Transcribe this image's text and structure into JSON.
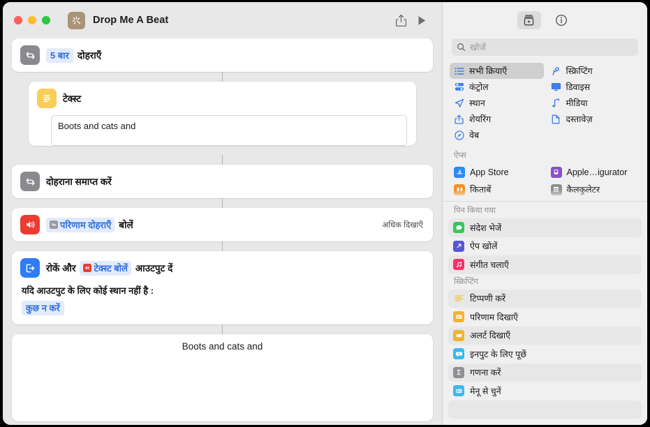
{
  "window": {
    "title": "Drop Me A Beat",
    "app_icon": "sparkle-wand-icon",
    "accent_blue": "#2f6fe0",
    "traffic_lights": [
      "close",
      "minimize",
      "zoom"
    ]
  },
  "toolbar": {
    "share_label": "share-icon",
    "run_label": "run-icon"
  },
  "workflow": {
    "actions": [
      {
        "name": "repeat",
        "icon": "repeat-icon",
        "icon_color": "#8a8a8e",
        "count_token": "5 बार",
        "label": "दोहराएँ"
      },
      {
        "name": "text",
        "icon": "text-icon",
        "icon_color": "#f7cf57",
        "label": "टेक्स्ट",
        "value": "Boots and cats and"
      },
      {
        "name": "end-repeat",
        "icon": "repeat-icon",
        "icon_color": "#8a8a8e",
        "label": "दोहराना समाप्त करें"
      },
      {
        "name": "speak",
        "icon": "speaker-icon",
        "icon_color": "#ec3b32",
        "token": "परिणाम दोहराएँ",
        "label": "बोलें",
        "show_more": "अधिक दिखाएँ"
      },
      {
        "name": "stop-and-output",
        "icon": "stop-output-icon",
        "icon_color": "#2f7cf6",
        "label_before": "रोकें और",
        "token": "टेक्स्ट बोलें",
        "label_after": "आउटपुट दें",
        "condition_label": "यदि आउटपुट के लिए कोई स्थान नहीं है :",
        "condition_token": "कुछ न करें"
      }
    ],
    "output_preview": "Boots and cats and"
  },
  "library": {
    "toolbar": {
      "library_icon": "action-library-icon",
      "info_icon": "info-icon"
    },
    "search": {
      "placeholder": "खोजें",
      "value": "",
      "icon": "search-icon"
    },
    "categories": [
      {
        "label": "सभी क्रियाएँ",
        "icon": "list-icon",
        "selected": true
      },
      {
        "label": "स्क्रिप्टिंग",
        "icon": "scripting-icon",
        "selected": false
      },
      {
        "label": "कंट्रोल",
        "icon": "controls-icon",
        "selected": false
      },
      {
        "label": "डिवाइस",
        "icon": "device-icon",
        "selected": false
      },
      {
        "label": "स्थान",
        "icon": "location-icon",
        "selected": false
      },
      {
        "label": "मीडिया",
        "icon": "media-note-icon",
        "selected": false
      },
      {
        "label": "शेयरिंग",
        "icon": "share-icon",
        "selected": false
      },
      {
        "label": "दस्तावेज़",
        "icon": "document-icon",
        "selected": false
      },
      {
        "label": "वेब",
        "icon": "web-compass-icon",
        "selected": false
      }
    ],
    "apps_section": {
      "header": "ऐप्स",
      "items": [
        {
          "label": "App Store",
          "icon": "app-store-icon",
          "color": "#2f8af6"
        },
        {
          "label": "Apple…igurator",
          "icon": "apple-configurator-icon",
          "color": "#8b4fc9"
        },
        {
          "label": "किताबें",
          "icon": "books-icon",
          "color": "#f59023"
        },
        {
          "label": "कैलकुलेटर",
          "icon": "calculator-icon",
          "color": "#8e8e93"
        }
      ]
    },
    "pinned_section": {
      "header": "पिन किया गया",
      "items": [
        {
          "label": "संदेश भेजें",
          "icon": "messages-icon",
          "color": "#35c759",
          "alt": true
        },
        {
          "label": "ऐप खोलें",
          "icon": "open-app-icon",
          "color": "#5656d6",
          "alt": false
        },
        {
          "label": "संगीत चलाएँ",
          "icon": "music-icon",
          "color": "#f8306c",
          "alt": true
        }
      ]
    },
    "scripting_section": {
      "header": "स्क्रिप्टिंग",
      "items": [
        {
          "label": "टिप्पणी करें",
          "icon": "comment-icon",
          "color": "#f7cf57",
          "alt": true
        },
        {
          "label": "परिणाम दिखाएँ",
          "icon": "show-result-icon",
          "color": "#f2b233",
          "alt": false
        },
        {
          "label": "अलर्ट दिखाएँ",
          "icon": "show-alert-icon",
          "color": "#f2b233",
          "alt": true
        },
        {
          "label": "इनपुट के लिए पूछें",
          "icon": "ask-input-icon",
          "color": "#3cb8ef",
          "alt": false
        },
        {
          "label": "गणना करें",
          "icon": "calculate-icon",
          "color": "#8e8e93",
          "alt": true
        },
        {
          "label": "मेनू से चुनें",
          "icon": "choose-menu-icon",
          "color": "#3cb8ef",
          "alt": false
        }
      ]
    }
  }
}
